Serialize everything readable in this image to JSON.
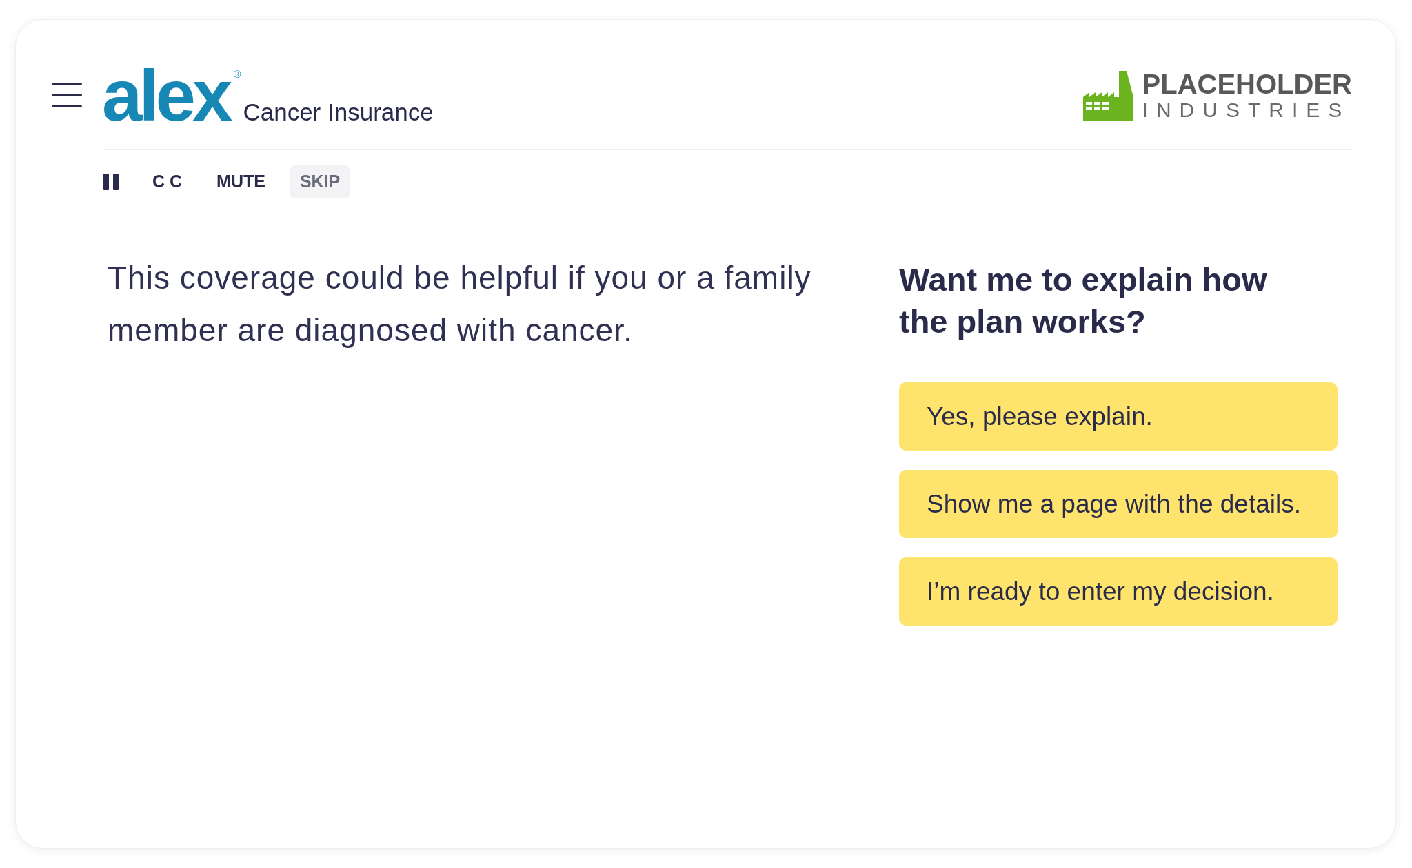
{
  "header": {
    "brand": {
      "logo": "alex",
      "registered_mark": "®",
      "product": "Cancer Insurance"
    },
    "partner_logo": {
      "name": "PLACEHOLDER",
      "tagline": "INDUSTRIES"
    }
  },
  "media_controls": [
    {
      "kind": "icon",
      "disabled": false
    },
    {
      "kind": "text",
      "label": "C C",
      "disabled": false
    },
    {
      "kind": "text",
      "label": "MUTE",
      "disabled": false
    },
    {
      "kind": "text",
      "label": "SKIP",
      "disabled": true
    }
  ],
  "message": "This coverage could be helpful if you or a family member are diagnosed with cancer.",
  "prompt": {
    "question": "Want me to explain how the plan works?",
    "options": [
      "Yes, please explain.",
      "Show me a page with the details.",
      "I’m ready to enter my decision."
    ]
  }
}
